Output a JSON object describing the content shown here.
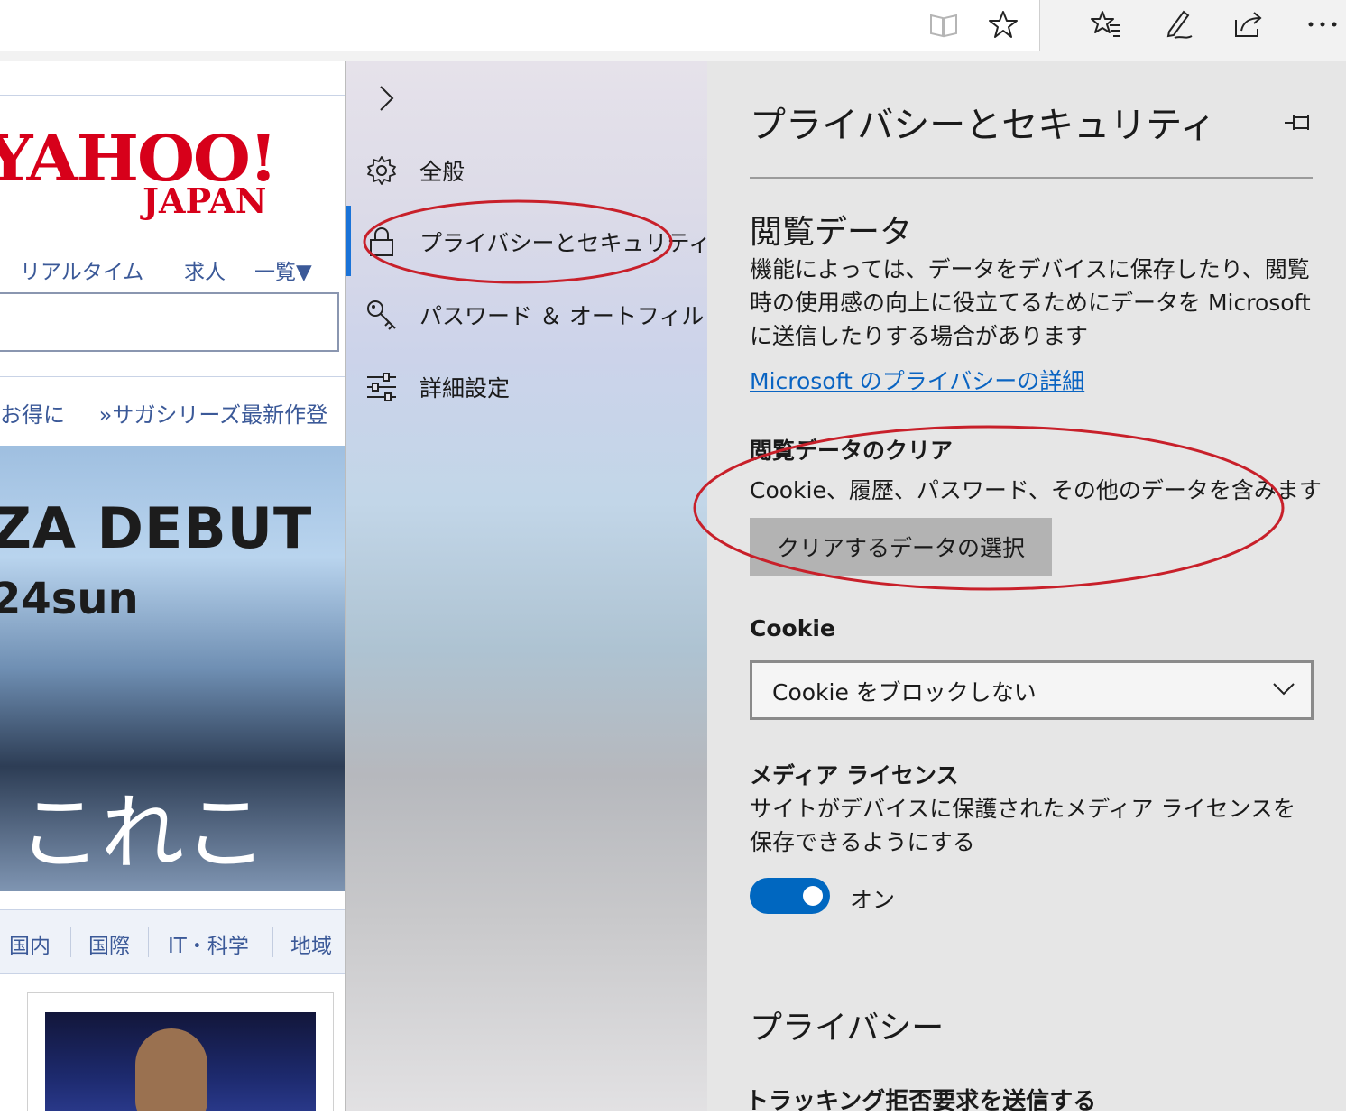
{
  "toolbar": {
    "icons": [
      "reading-view-icon",
      "favorite-star-icon",
      "favorites-hub-icon",
      "web-note-icon",
      "share-icon",
      "more-icon"
    ]
  },
  "background_page": {
    "logo_main": "YAHOO!",
    "logo_sub": "JAPAN",
    "nav_links": [
      "リアルタイム",
      "求人",
      "一覧▼"
    ],
    "promo_left": "お得に",
    "promo_right": "»サガシリーズ最新作登",
    "banner_line1": "ZA DEBUT",
    "banner_line2": "24sun",
    "banner_line3": "これこ",
    "categories": [
      "国内",
      "国際",
      "IT・科学",
      "地域"
    ]
  },
  "nav": {
    "items": [
      {
        "label": "全般",
        "icon": "gear-icon"
      },
      {
        "label": "プライバシーとセキュリティ",
        "icon": "lock-icon"
      },
      {
        "label": "パスワード ＆ オートフィル",
        "icon": "key-icon"
      },
      {
        "label": "詳細設定",
        "icon": "sliders-icon"
      }
    ]
  },
  "settings": {
    "title": "プライバシーとセキュリティ",
    "browsing_data": {
      "heading": "閲覧データ",
      "description": "機能によっては、データをデバイスに保存したり、閲覧時の使用感の向上に役立てるためにデータを Microsoft に送信したりする場合があります",
      "link": "Microsoft のプライバシーの詳細"
    },
    "clear_data": {
      "heading": "閲覧データのクリア",
      "description": "Cookie、履歴、パスワード、その他のデータを含みます",
      "button": "クリアするデータの選択"
    },
    "cookie": {
      "heading": "Cookie",
      "selected": "Cookie をブロックしない"
    },
    "media_license": {
      "heading": "メディア ライセンス",
      "description": "サイトがデバイスに保護されたメディア ライセンスを保存できるようにする",
      "toggle_label": "オン",
      "toggle_on": true
    },
    "privacy": {
      "heading": "プライバシー",
      "dnt_heading": "トラッキング拒否要求を送信する"
    }
  },
  "colors": {
    "accent": "#0067c0",
    "link": "#0a64c2",
    "annotation": "#c8202a",
    "yahoo_red": "#d7001a"
  }
}
